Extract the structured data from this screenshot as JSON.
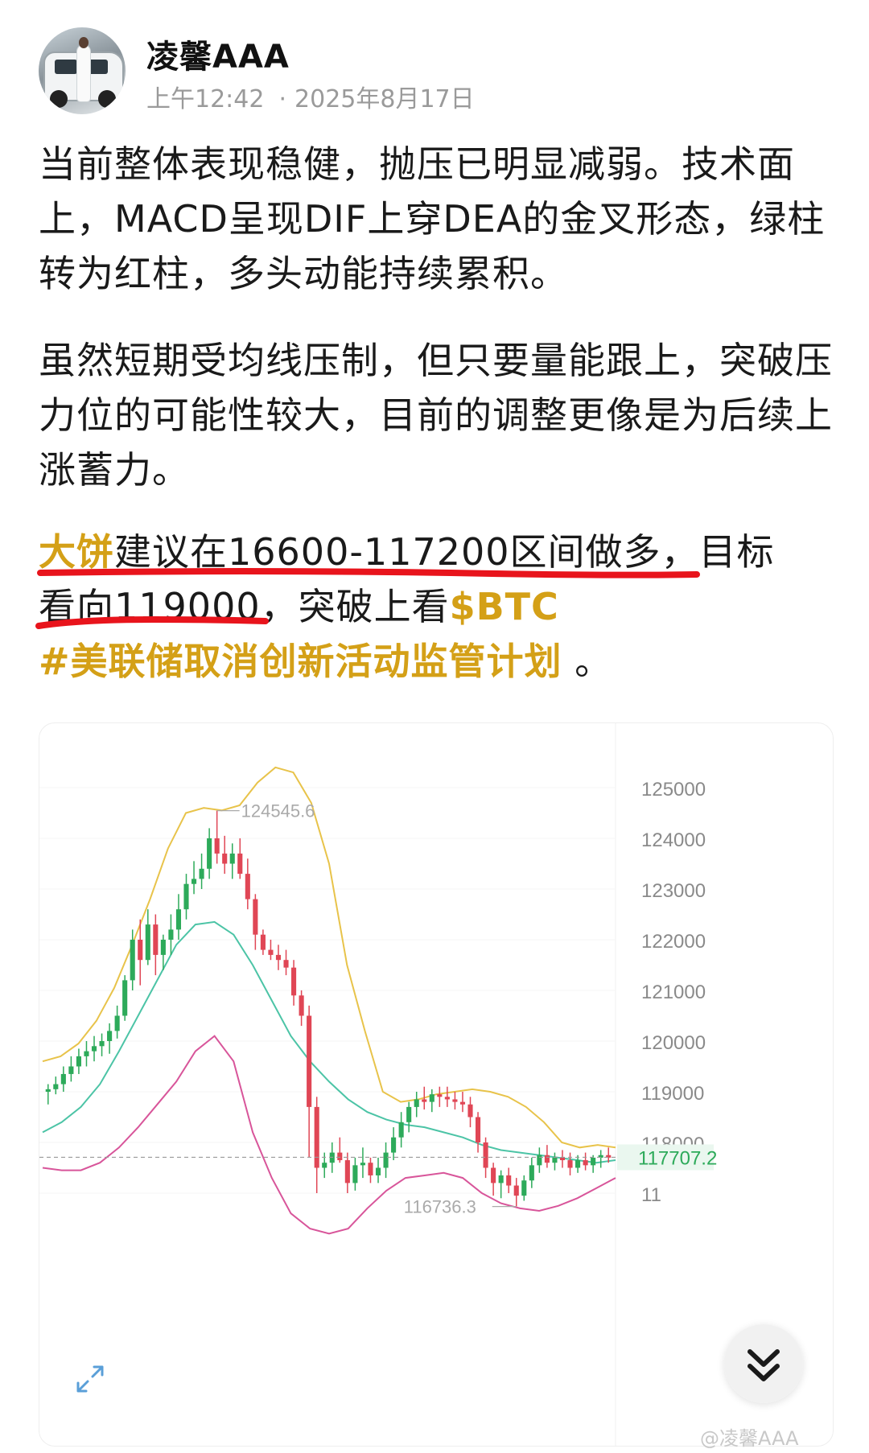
{
  "post": {
    "username": "凌馨AAA",
    "time": "上午12:42",
    "separator": "·",
    "date": "2025年8月17日",
    "paragraph1": "当前整体表现稳健，抛压已明显减弱。技术面上，MACD呈现DIF上穿DEA的金叉形态，绿柱转为红柱，多头动能持续累积。",
    "paragraph2": "虽然短期受均线压制，但只要量能跟上，突破压力位的可能性较大，目前的调整更像是为后续上涨蓄力。",
    "paragraph3_highlight": "大饼",
    "paragraph3_line1_rest": "建议在16600-117200区间做多，目标",
    "paragraph3_line2": "看向119000，突破上看",
    "cashtag": "$BTC",
    "hashtag": "#美联储取消创新活动监管计划",
    "hashtag_suffix": " 。",
    "watermark": "@凌馨AAA"
  },
  "colors": {
    "accent": "#d4a017",
    "underline": "#e8141c",
    "candle_up": "#2daa5a",
    "candle_down": "#e04655",
    "band_upper": "#e8c34a",
    "band_mid": "#4cc4a6",
    "band_lower": "#d8559a"
  },
  "icons": {
    "expand": "expand-icon",
    "down": "chevron-down-double-icon"
  },
  "chart_data": {
    "type": "candlestick",
    "ylim": [
      116000,
      125700
    ],
    "y_ticks": [
      125000,
      124000,
      123000,
      122000,
      121000,
      120000,
      119000,
      118000,
      117000
    ],
    "y_tick_labels": [
      "125000",
      "124000",
      "123000",
      "122000",
      "121000",
      "120000",
      "119000",
      "118000",
      "11"
    ],
    "current_price_label": "117707.2",
    "current_price": 117707,
    "max_label": "124545.6",
    "min_label": "116736.3",
    "max_value": 124545.6,
    "min_value": 116736.3,
    "candles": [
      [
        119000,
        119150,
        118750,
        119050
      ],
      [
        119050,
        119300,
        118950,
        119150
      ],
      [
        119150,
        119500,
        119000,
        119350
      ],
      [
        119350,
        119700,
        119200,
        119500
      ],
      [
        119500,
        119850,
        119350,
        119700
      ],
      [
        119700,
        120000,
        119500,
        119800
      ],
      [
        119800,
        120100,
        119600,
        119900
      ],
      [
        119900,
        120150,
        119700,
        120000
      ],
      [
        120000,
        120350,
        119750,
        120200
      ],
      [
        120200,
        120700,
        120050,
        120500
      ],
      [
        120500,
        121300,
        120400,
        121200
      ],
      [
        121200,
        122200,
        121000,
        122000
      ],
      [
        122000,
        122400,
        121100,
        121600
      ],
      [
        121600,
        122600,
        121500,
        122300
      ],
      [
        122300,
        122500,
        121300,
        121700
      ],
      [
        121700,
        122100,
        121400,
        122000
      ],
      [
        122000,
        122500,
        121700,
        122200
      ],
      [
        122200,
        122900,
        122000,
        122600
      ],
      [
        122600,
        123300,
        122400,
        123100
      ],
      [
        123100,
        123550,
        122900,
        123200
      ],
      [
        123200,
        123700,
        123000,
        123400
      ],
      [
        123400,
        124200,
        123200,
        124000
      ],
      [
        124000,
        124545,
        123500,
        123700
      ],
      [
        123700,
        124050,
        123300,
        123500
      ],
      [
        123500,
        123900,
        123200,
        123700
      ],
      [
        123700,
        124000,
        123200,
        123300
      ],
      [
        123300,
        123600,
        122600,
        122800
      ],
      [
        122800,
        122900,
        121800,
        122100
      ],
      [
        122100,
        122200,
        121700,
        121800
      ],
      [
        121800,
        122000,
        121600,
        121700
      ],
      [
        121700,
        121900,
        121400,
        121600
      ],
      [
        121600,
        121800,
        121300,
        121450
      ],
      [
        121450,
        121600,
        120700,
        120900
      ],
      [
        120900,
        121000,
        120300,
        120500
      ],
      [
        120500,
        120700,
        117700,
        118700
      ],
      [
        118700,
        118900,
        117000,
        117500
      ],
      [
        117500,
        117800,
        117300,
        117600
      ],
      [
        117600,
        118000,
        117400,
        117800
      ],
      [
        117800,
        118100,
        117600,
        117650
      ],
      [
        117650,
        117800,
        117000,
        117200
      ],
      [
        117200,
        117700,
        117050,
        117550
      ],
      [
        117550,
        117900,
        117300,
        117600
      ],
      [
        117600,
        117700,
        117200,
        117350
      ],
      [
        117350,
        117700,
        117200,
        117500
      ],
      [
        117500,
        118000,
        117300,
        117800
      ],
      [
        117800,
        118300,
        117650,
        118100
      ],
      [
        118100,
        118600,
        117900,
        118400
      ],
      [
        118400,
        118800,
        118200,
        118700
      ],
      [
        118700,
        119000,
        118500,
        118850
      ],
      [
        118850,
        119100,
        118650,
        118800
      ],
      [
        118800,
        119050,
        118600,
        118950
      ],
      [
        118950,
        119100,
        118700,
        118900
      ],
      [
        118900,
        119100,
        118700,
        118850
      ],
      [
        118850,
        119000,
        118650,
        118800
      ],
      [
        118800,
        119000,
        118600,
        118750
      ],
      [
        118750,
        118900,
        118300,
        118500
      ],
      [
        118500,
        118600,
        117800,
        118000
      ],
      [
        118000,
        118100,
        117300,
        117500
      ],
      [
        117500,
        117600,
        116950,
        117200
      ],
      [
        117200,
        117450,
        116900,
        117350
      ],
      [
        117350,
        117500,
        117000,
        117150
      ],
      [
        117150,
        117300,
        116736,
        116950
      ],
      [
        116950,
        117350,
        116850,
        117250
      ],
      [
        117250,
        117700,
        117100,
        117550
      ],
      [
        117550,
        117900,
        117400,
        117750
      ],
      [
        117750,
        117950,
        117500,
        117600
      ],
      [
        117600,
        117800,
        117450,
        117700
      ],
      [
        117700,
        117850,
        117500,
        117650
      ],
      [
        117650,
        117800,
        117350,
        117500
      ],
      [
        117500,
        117750,
        117400,
        117650
      ],
      [
        117650,
        117800,
        117450,
        117550
      ],
      [
        117550,
        117750,
        117400,
        117700
      ],
      [
        117700,
        117850,
        117500,
        117750
      ],
      [
        117750,
        117900,
        117600,
        117700
      ]
    ],
    "band_upper": [
      119600,
      119700,
      119950,
      120400,
      121050,
      121900,
      122800,
      123800,
      124500,
      124600,
      124550,
      124650,
      125100,
      125400,
      125300,
      124700,
      123500,
      121500,
      120200,
      119000,
      118800,
      118850,
      118950,
      119000,
      119050,
      119000,
      118900,
      118700,
      118400,
      118000,
      117900,
      117950,
      117900
    ],
    "band_mid": [
      118200,
      118400,
      118700,
      119150,
      119800,
      120500,
      121200,
      121900,
      122300,
      122350,
      122100,
      121500,
      120800,
      120100,
      119600,
      119200,
      118850,
      118600,
      118450,
      118350,
      118300,
      118200,
      118100,
      117950,
      117850,
      117800,
      117750,
      117700,
      117650,
      117600,
      117650
    ],
    "band_lower": [
      117500,
      117450,
      117450,
      117600,
      117900,
      118300,
      118750,
      119200,
      119800,
      120100,
      119600,
      118200,
      117300,
      116600,
      116300,
      116200,
      116300,
      116700,
      117050,
      117300,
      117350,
      117400,
      117300,
      117000,
      116800,
      116700,
      116650,
      116750,
      116900,
      117100,
      117300
    ]
  }
}
